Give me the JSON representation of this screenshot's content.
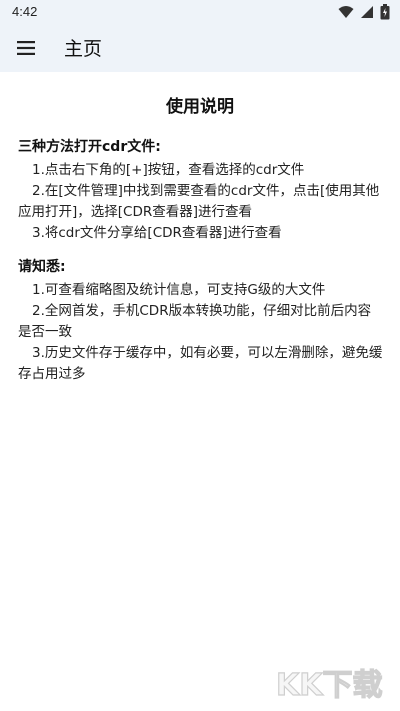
{
  "status": {
    "time": "4:42"
  },
  "app_bar": {
    "title": "主页"
  },
  "main": {
    "heading": "使用说明",
    "sections": [
      {
        "title": "三种方法打开cdr文件:",
        "items": [
          "1.点击右下角的[+]按钮，查看选择的cdr文件",
          "2.在[文件管理]中找到需要查看的cdr文件，点击[使用其他应用打开]，选择[CDR查看器]进行查看",
          "3.将cdr文件分享给[CDR查看器]进行查看"
        ]
      },
      {
        "title": "请知悉:",
        "items": [
          "1.可查看缩略图及统计信息，可支持G级的大文件",
          "2.全网首发，手机CDR版本转换功能，仔细对比前后内容是否一致",
          "3.历史文件存于缓存中，如有必要，可以左滑删除，避免缓存占用过多"
        ]
      }
    ]
  },
  "watermark": {
    "text": "KK下载"
  },
  "colors": {
    "app_bar_bg": "#eef3f9",
    "text": "#111111"
  }
}
